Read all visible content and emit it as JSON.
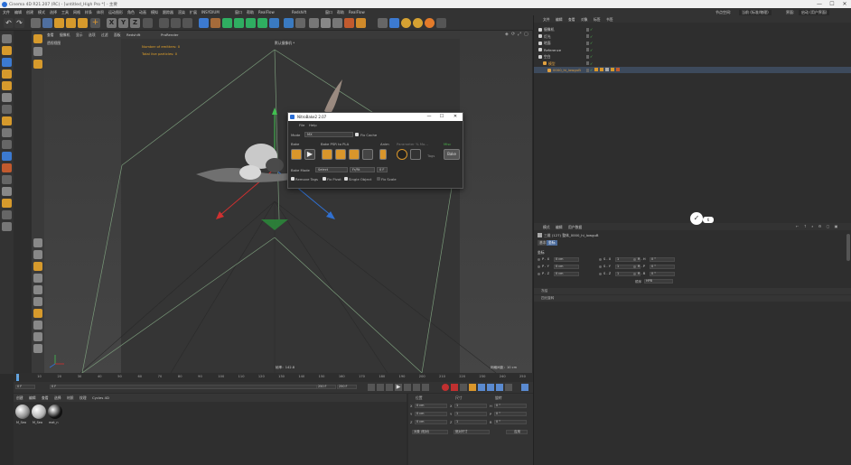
{
  "app": {
    "title": "Cinema 4D R21.207 (RC) - [untitled_High Pro *] - 主要",
    "controls": {
      "minimize": "—",
      "maximize": "☐",
      "close": "✕"
    }
  },
  "menu": {
    "items": [
      "文件",
      "编辑",
      "创建",
      "模式",
      "选择",
      "工具",
      "网格",
      "样条",
      "体积",
      "运动图形",
      "角色",
      "动画",
      "模拟",
      "跟踪器",
      "渲染",
      "扩展",
      "INSYDIUM",
      "窗口",
      "帮助",
      "RealFlow",
      "Redshift",
      "窗口",
      "帮助",
      "RealFlow"
    ],
    "layout_label": "界面:",
    "layout_value": "启动 (用户界面)",
    "node_label": "节点空间:",
    "node_value": "当前 (标准/物理)"
  },
  "viewport": {
    "menu": [
      "查看",
      "摄像机",
      "显示",
      "选项",
      "过滤",
      "面板",
      "Redshift",
      "ProRender"
    ],
    "camera_label": "透视视图",
    "camera_default": "默认摄像机 *",
    "hud_emitters": "Number of emitters: 0",
    "hud_particles": "Total live particles: 0",
    "grid_info": "网格间距：10 cm",
    "speed": "帧率：142.8",
    "axis_labels": [
      "X",
      "Y",
      "Z"
    ]
  },
  "dialog": {
    "title": "NitroBake2 2.07",
    "menu": [
      "File",
      "Help"
    ],
    "mode_label": "Mode",
    "mode_value": "MX",
    "fix_cache": "Fix Cache",
    "bake_label": "Bake",
    "bake_psr": "Bake PSR to PLA",
    "anim_label": "Anim",
    "parameter": "Parameter % Mo...",
    "misc": "Misc",
    "tags": "Tags",
    "bake_btn": "Bake",
    "bake_mode_label": "Bake Mode",
    "bake_mode_value": "Select",
    "fps_value": "Fr/Rt",
    "fps_num": "0 F",
    "remove_tags": "Remove Tags",
    "fix_pivot": "Fix Pivot",
    "single_object": "Single Object",
    "fix_scale": "Fix Scale"
  },
  "objects": {
    "menu": [
      "文件",
      "编辑",
      "查看",
      "对象",
      "标签",
      "书签"
    ],
    "rows": [
      {
        "name": "摄像机",
        "indent": 0,
        "color": "#d0d0d0"
      },
      {
        "name": "灯光",
        "indent": 0,
        "color": "#d0d0d0"
      },
      {
        "name": "地面",
        "indent": 0,
        "color": "#d0d0d0"
      },
      {
        "name": "Reference",
        "indent": 0,
        "color": "#d0d0d0"
      },
      {
        "name": "空白",
        "indent": 0,
        "color": "#d0d0d0"
      },
      {
        "name": "模型",
        "indent": 1,
        "color": "#e0a040"
      },
      {
        "name": "0000_hi_lowguB",
        "indent": 2,
        "color": "#e0a040",
        "selected": true
      }
    ]
  },
  "attributes": {
    "menu": [
      "模式",
      "编辑",
      "用户数据"
    ],
    "object_line": "三维 (127) 整体_0000_hi_lowguB",
    "tabs": [
      "基本",
      "坐标"
    ],
    "section": "坐标",
    "rows": [
      {
        "p": "P . X",
        "pv": "0 cm",
        "s": "S . X",
        "sv": "1",
        "r": "R . H",
        "rv": "0 °"
      },
      {
        "p": "P . Y",
        "pv": "0 cm",
        "s": "S . Y",
        "sv": "1",
        "r": "R . P",
        "rv": "0 °"
      },
      {
        "p": "P . Z",
        "pv": "0 cm",
        "s": "S . Z",
        "sv": "1",
        "r": "R . B",
        "rv": "0 °"
      }
    ],
    "order_label": "顺序",
    "order_value": "HPB",
    "collapsed": [
      "冻结",
      "四元旋转"
    ],
    "badge": "6"
  },
  "timeline": {
    "ticks": [
      "0",
      "10",
      "20",
      "30",
      "40",
      "50",
      "60",
      "70",
      "80",
      "90",
      "100",
      "110",
      "120",
      "130",
      "140",
      "150",
      "160",
      "170",
      "180",
      "190",
      "200",
      "210",
      "220",
      "230",
      "240",
      "250"
    ],
    "current": "0 F",
    "start": "0 F",
    "end": "250 F",
    "end2": "250 F"
  },
  "materials": {
    "menu": [
      "创建",
      "编辑",
      "查看",
      "选择",
      "材质",
      "纹理",
      "Cycles 4D"
    ],
    "items": [
      {
        "label": "M_Sea",
        "color": "#8a8a8a"
      },
      {
        "label": "M_Sea",
        "color": "#b0b0b0"
      },
      {
        "label": "mat_n",
        "color": "#111111"
      }
    ]
  },
  "coords": {
    "headers": [
      "位置",
      "尺寸",
      "旋转"
    ],
    "rows": [
      {
        "a": "X",
        "av": "0 cm",
        "b": "X",
        "bv": "1",
        "c": "H",
        "cv": "0 °"
      },
      {
        "a": "Y",
        "av": "0 cm",
        "b": "Y",
        "bv": "1",
        "c": "P",
        "cv": "0 °"
      },
      {
        "a": "Z",
        "av": "0 cm",
        "b": "Z",
        "bv": "1",
        "c": "B",
        "cv": "0 °"
      }
    ],
    "mode1": "对象 (相对)",
    "mode2": "绝对尺寸",
    "apply": "应用"
  }
}
